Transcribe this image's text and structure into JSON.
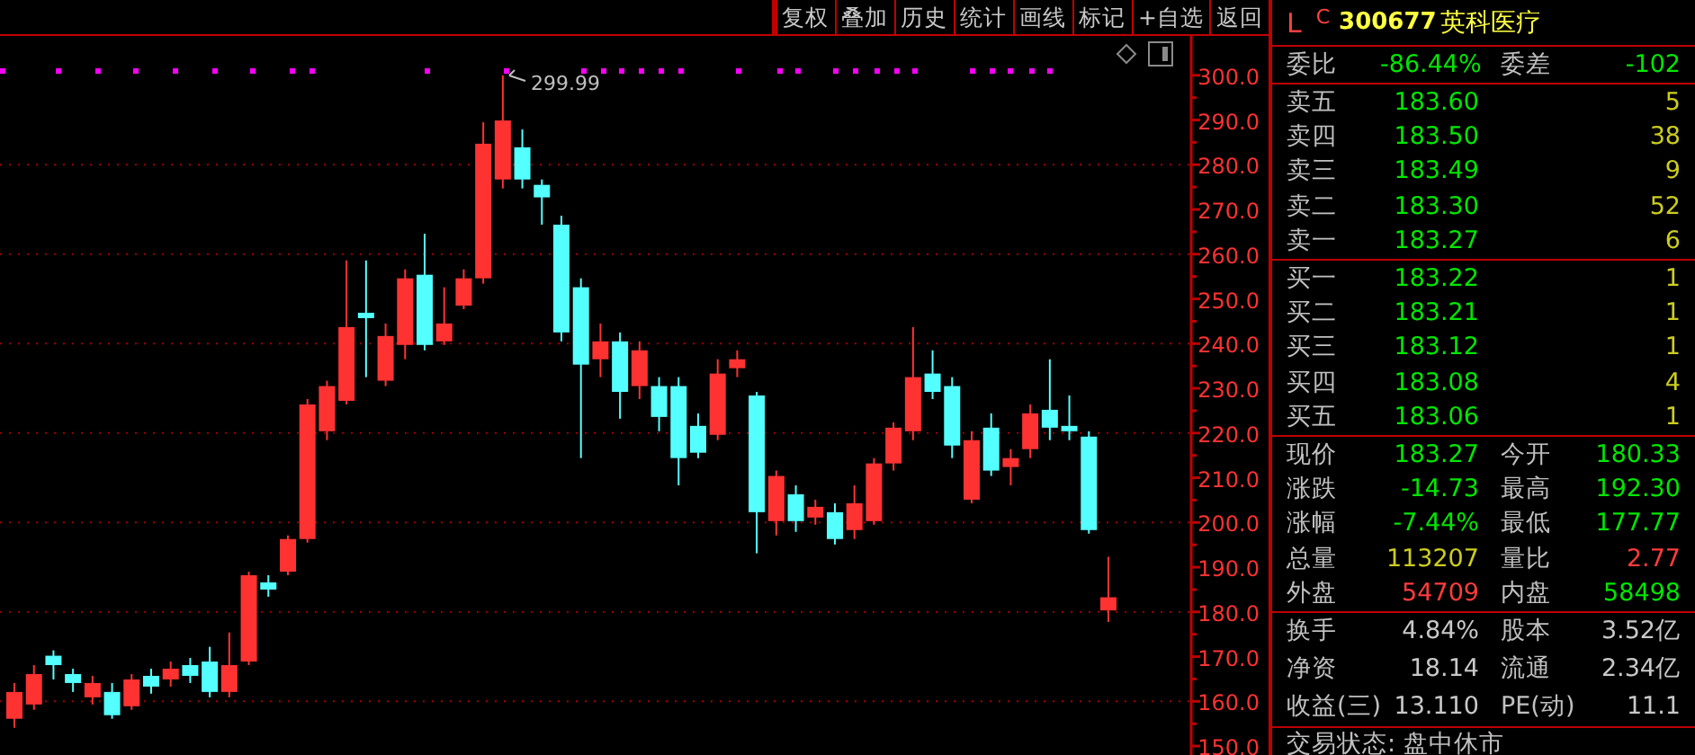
{
  "toolbar": {
    "buttons": [
      "复权",
      "叠加",
      "历史",
      "统计",
      "画线",
      "标记",
      "+自选",
      "返回"
    ]
  },
  "chart": {
    "peak_label": "299.99",
    "chart_data": {
      "type": "candlestick",
      "grid": true,
      "ohlc": [
        [
          156.1,
          164.1,
          154.1,
          162.1
        ],
        [
          159.3,
          168.1,
          158.1,
          166.1
        ],
        [
          170.2,
          171.4,
          164.9,
          168.1
        ],
        [
          166.1,
          167.3,
          162.1,
          164.1
        ],
        [
          160.9,
          165.7,
          159.3,
          164.1
        ],
        [
          162.1,
          164.1,
          156.1,
          156.9
        ],
        [
          158.9,
          166.1,
          158.1,
          164.9
        ],
        [
          165.7,
          167.3,
          161.7,
          163.3
        ],
        [
          164.9,
          168.9,
          163.3,
          167.3
        ],
        [
          168.1,
          169.7,
          164.1,
          165.7
        ],
        [
          168.9,
          172.2,
          160.9,
          162.1
        ],
        [
          162.1,
          175.4,
          160.9,
          168.1
        ],
        [
          168.9,
          189.0,
          168.1,
          188.2
        ],
        [
          186.6,
          188.2,
          183.4,
          185.0
        ],
        [
          189.0,
          197.1,
          188.2,
          196.3
        ],
        [
          196.3,
          227.6,
          195.5,
          226.4
        ],
        [
          220.4,
          231.7,
          218.4,
          230.5
        ],
        [
          227.2,
          258.6,
          226.4,
          243.7
        ],
        [
          246.9,
          258.6,
          232.5,
          245.7
        ],
        [
          231.7,
          244.5,
          230.5,
          241.7
        ],
        [
          239.7,
          256.6,
          236.5,
          254.6
        ],
        [
          255.4,
          264.6,
          238.5,
          239.7
        ],
        [
          240.5,
          252.6,
          239.7,
          244.5
        ],
        [
          248.5,
          256.6,
          247.7,
          254.6
        ],
        [
          254.6,
          289.5,
          253.4,
          284.7
        ],
        [
          276.7,
          299.99,
          274.7,
          289.9
        ],
        [
          283.9,
          287.9,
          274.7,
          276.7
        ],
        [
          275.5,
          276.7,
          266.6,
          272.7
        ],
        [
          266.6,
          268.6,
          240.5,
          242.5
        ],
        [
          252.6,
          254.6,
          214.4,
          235.3
        ],
        [
          236.5,
          244.5,
          232.5,
          240.5
        ],
        [
          240.5,
          242.5,
          223.2,
          229.2
        ],
        [
          230.5,
          240.5,
          227.6,
          238.5
        ],
        [
          230.5,
          232.5,
          220.4,
          223.6
        ],
        [
          230.5,
          232.5,
          208.3,
          214.4
        ],
        [
          221.6,
          224.4,
          214.4,
          215.6
        ],
        [
          219.6,
          236.5,
          218.4,
          233.3
        ],
        [
          234.5,
          238.5,
          232.5,
          236.5
        ],
        [
          228.4,
          229.2,
          193.1,
          202.3
        ],
        [
          200.3,
          211.6,
          197.1,
          210.4
        ],
        [
          206.3,
          208.3,
          197.9,
          200.3
        ],
        [
          201.1,
          205.1,
          199.5,
          203.5
        ],
        [
          202.3,
          204.3,
          195.1,
          196.3
        ],
        [
          198.3,
          208.3,
          196.3,
          204.3
        ],
        [
          200.3,
          214.4,
          199.5,
          213.2
        ],
        [
          213.2,
          222.4,
          211.6,
          221.2
        ],
        [
          220.4,
          243.7,
          218.4,
          232.5
        ],
        [
          233.3,
          238.5,
          227.6,
          229.2
        ],
        [
          230.5,
          232.5,
          214.4,
          217.2
        ],
        [
          205.1,
          220.4,
          204.3,
          218.4
        ],
        [
          221.2,
          224.4,
          210.4,
          211.6
        ],
        [
          212.4,
          216.4,
          208.3,
          214.4
        ],
        [
          216.4,
          226.4,
          214.4,
          224.4
        ],
        [
          225.2,
          236.5,
          218.4,
          221.2
        ],
        [
          221.6,
          228.4,
          218.4,
          220.4
        ],
        [
          219.2,
          220.4,
          197.5,
          198.3
        ],
        [
          180.33,
          192.3,
          177.77,
          183.27
        ]
      ],
      "ylim": [
        148,
        308.8
      ],
      "yticks": [
        {
          "value": 300,
          "label": "300.0"
        },
        {
          "value": 290,
          "label": "290.0"
        },
        {
          "value": 280,
          "label": "280.0"
        },
        {
          "value": 270,
          "label": "270.0"
        },
        {
          "value": 260,
          "label": "260.0"
        },
        {
          "value": 250,
          "label": "250.0"
        },
        {
          "value": 240,
          "label": "240.0"
        },
        {
          "value": 230,
          "label": "230.0"
        },
        {
          "value": 220,
          "label": "220.0"
        },
        {
          "value": 210,
          "label": "210.0"
        },
        {
          "value": 200,
          "label": "200.0"
        },
        {
          "value": 190,
          "label": "190.0"
        },
        {
          "value": 180,
          "label": "180.0"
        },
        {
          "value": 170,
          "label": "170.0"
        },
        {
          "value": 160,
          "label": "160.0"
        },
        {
          "value": 150,
          "label": "150.0"
        }
      ]
    }
  },
  "quote": {
    "market_flag": "L",
    "class_flag": "C",
    "code": "300677",
    "name": "英科医疗"
  },
  "order_ratio": [
    {
      "label": "委比",
      "value": "-86.44%",
      "color": "#00e600"
    },
    {
      "label": "委差",
      "value": "-102",
      "color": "#00e600"
    }
  ],
  "asks": [
    {
      "label": "卖五",
      "price": "183.60",
      "volume": "5"
    },
    {
      "label": "卖四",
      "price": "183.50",
      "volume": "38"
    },
    {
      "label": "卖三",
      "price": "183.49",
      "volume": "9"
    },
    {
      "label": "卖二",
      "price": "183.30",
      "volume": "52"
    },
    {
      "label": "卖一",
      "price": "183.27",
      "volume": "6"
    }
  ],
  "bids": [
    {
      "label": "买一",
      "price": "183.22",
      "volume": "1"
    },
    {
      "label": "买二",
      "price": "183.21",
      "volume": "1"
    },
    {
      "label": "买三",
      "price": "183.12",
      "volume": "1"
    },
    {
      "label": "买四",
      "price": "183.08",
      "volume": "4"
    },
    {
      "label": "买五",
      "price": "183.06",
      "volume": "1"
    }
  ],
  "stats": [
    {
      "label": "现价",
      "value": "183.27",
      "color": "#00e600"
    },
    {
      "label": "今开",
      "value": "180.33",
      "color": "#00e600"
    },
    {
      "label": "涨跌",
      "value": "-14.73",
      "color": "#00e600"
    },
    {
      "label": "最高",
      "value": "192.30",
      "color": "#00e600"
    },
    {
      "label": "涨幅",
      "value": "-7.44%",
      "color": "#00e600"
    },
    {
      "label": "最低",
      "value": "177.77",
      "color": "#00e600"
    },
    {
      "label": "总量",
      "value": "113207",
      "color": "#cccc20"
    },
    {
      "label": "量比",
      "value": "2.77",
      "color": "#ff3c3c"
    },
    {
      "label": "外盘",
      "value": "54709",
      "color": "#ff3c3c"
    },
    {
      "label": "内盘",
      "value": "58498",
      "color": "#00e600"
    }
  ],
  "fundamentals": [
    {
      "label": "换手",
      "value": "4.84%"
    },
    {
      "label": "股本",
      "value": "3.52亿"
    },
    {
      "label": "净资",
      "value": "18.14"
    },
    {
      "label": "流通",
      "value": "2.34亿"
    },
    {
      "label": "收益(三)",
      "value": "13.110"
    },
    {
      "label": "PE(动)",
      "value": "11.1"
    }
  ],
  "status": "交易状态: 盘中休市"
}
